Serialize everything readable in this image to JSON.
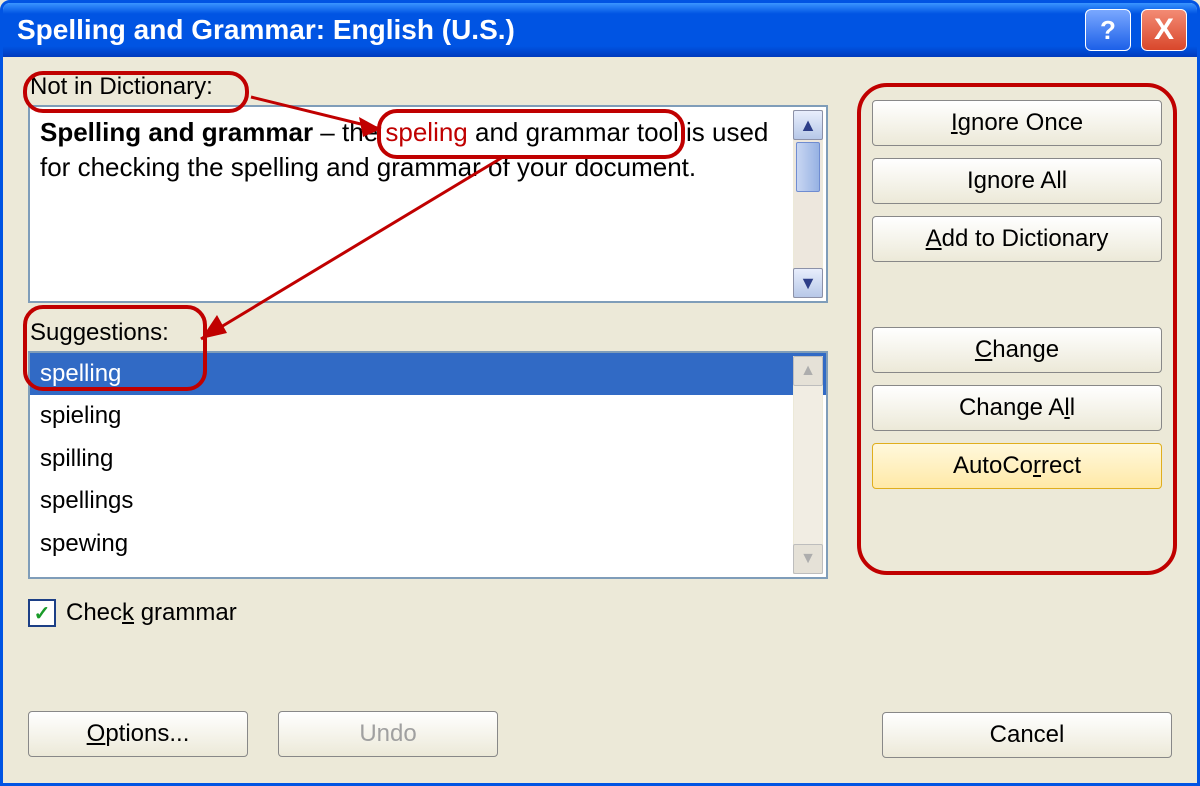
{
  "window": {
    "title": "Spelling and Grammar: English (U.S.)",
    "help_symbol": "?",
    "close_symbol": "X"
  },
  "labels": {
    "not_in_dictionary": "Not in Dictionary:",
    "suggestions": "Suggestions:"
  },
  "context_sentence": {
    "prefix": "Spelling and grammar",
    "dash": " – ",
    "before_err": "the ",
    "error_word": "speling",
    "after_err": " and grammar tool is used for checking the spelling and grammar of your document."
  },
  "suggestions": {
    "items": [
      "spelling",
      "spieling",
      "spilling",
      "spellings",
      "spewing"
    ],
    "selected_index": 0
  },
  "check_grammar": {
    "label": "Check grammar",
    "checked": true,
    "hotkey_index": 4
  },
  "buttons": {
    "ignore_once": {
      "label": "Ignore Once",
      "hotkey": "I"
    },
    "ignore_all": {
      "label": "Ignore All",
      "hotkey": "g"
    },
    "add_to_dict": {
      "label": "Add to Dictionary",
      "hotkey": "A"
    },
    "change": {
      "label": "Change",
      "hotkey": "C"
    },
    "change_all": {
      "label": "Change All",
      "hotkey": "l"
    },
    "autocorrect": {
      "label": "AutoCorrect",
      "hotkey": "R"
    },
    "options": {
      "label": "Options...",
      "hotkey": "O"
    },
    "undo": {
      "label": "Undo",
      "hotkey": "U",
      "enabled": false
    },
    "cancel": {
      "label": "Cancel"
    }
  },
  "scroll_glyphs": {
    "up": "▲",
    "down": "▼"
  }
}
